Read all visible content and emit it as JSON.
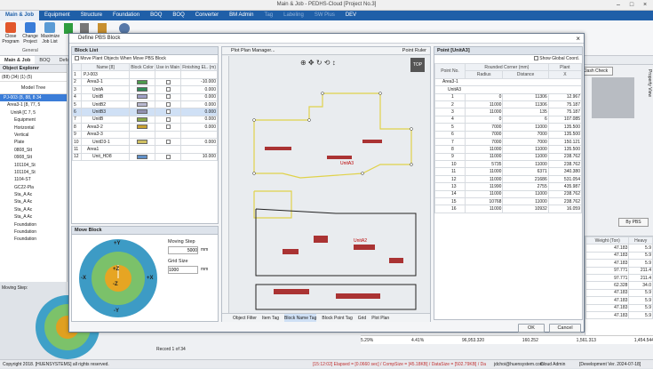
{
  "window": {
    "title": "Main & Job - PEDHS-Cloud [Project No.3]"
  },
  "menu": [
    "Main & Job",
    "Equipment",
    "Structure",
    "Foundation",
    "BOQ",
    "BOQ",
    "Converter",
    "BM Admin",
    "Tag",
    "Labeling",
    "SW Plus",
    "DEV"
  ],
  "ribbon": {
    "buttons": [
      "Close Program",
      "Change Project",
      "Maximize Job List"
    ],
    "group": "General"
  },
  "subtabs": [
    "Main & Job",
    "BOQ",
    "Defa"
  ],
  "explorer": {
    "title": "Object Explorer",
    "filters": [
      "(88)",
      "(34)",
      "(1)",
      "(5)"
    ],
    "col": "Model Tree",
    "rows": [
      "PJ-003 (8, 88, 8 34",
      "Area3-1 [8, 77, 5",
      "UnitA [C 7, 5",
      "Equipment",
      "Horizontal",
      "Vertical",
      "Plate",
      "0808_Stt",
      "0908_Stt",
      "101104_St",
      "101104_St",
      "1104-ST",
      "GC22-Pla",
      "Sta_A Ac",
      "Sta_A Ac",
      "Sta_A Ac",
      "Sta_A Ac",
      "Foundation",
      "Foundation",
      "Foundation"
    ],
    "moving_step": "Moving Step:"
  },
  "status": {
    "copyright": "Copyright 2018. [HUENSYSTEMS] all rights reserved.",
    "record": "Record 1 of 34",
    "log": "[15:12:02] Elapsed = [0.0660 sec] / CompSize = [45.18KB] / DataSize = [502.79KB] / Da",
    "user": "jdchoi@huensystem.com",
    "brand": "Cloud Admin",
    "version": "[Development Ver. 2024-07-18]"
  },
  "dialog": {
    "title": "Define PBS Block",
    "close": "×",
    "ok": "OK",
    "cancel": "Cancel"
  },
  "block_list": {
    "title": "Block List",
    "check_label": "Move Plant Objects When Move PBS Block",
    "headers": [
      "Name [8]",
      "Block Color",
      "Use in Main",
      "Finishing EL. (m)"
    ],
    "rows": [
      {
        "n": "1",
        "name": "PJ-003",
        "color": "",
        "use": false,
        "el": ""
      },
      {
        "n": "2",
        "name": "Area3-1",
        "color": "#4d9a4d",
        "use": true,
        "el": "-10.000"
      },
      {
        "n": "3",
        "name": "UnitA",
        "color": "#2e8b57",
        "use": true,
        "el": "0.000"
      },
      {
        "n": "4",
        "name": "UnitB",
        "color": "#a0a0c8",
        "use": true,
        "el": "0.000"
      },
      {
        "n": "5",
        "name": "UnitB2",
        "color": "#b8b8d0",
        "use": true,
        "el": "0.000"
      },
      {
        "n": "6",
        "name": "UnitB3",
        "color": "#9090b0",
        "use": true,
        "el": "0.000"
      },
      {
        "n": "7",
        "name": "UnitB",
        "color": "#88a848",
        "use": true,
        "el": "0.000"
      },
      {
        "n": "8",
        "name": "Area3-2",
        "color": "#c8a030",
        "use": true,
        "el": "0.000"
      },
      {
        "n": "9",
        "name": "Area3-3",
        "color": "",
        "use": false,
        "el": ""
      },
      {
        "n": "10",
        "name": "UnitD3-1",
        "color": "#d0c060",
        "use": true,
        "el": "0.000"
      },
      {
        "n": "11",
        "name": "Area1",
        "color": "",
        "use": false,
        "el": ""
      },
      {
        "n": "12",
        "name": "Unit_HD8",
        "color": "#6090c8",
        "use": true,
        "el": "10.000"
      }
    ]
  },
  "move_block": {
    "title": "Move Block",
    "moving_step_label": "Moving Step",
    "moving_step": "5000",
    "grid_size_label": "Grid Size",
    "grid_size": "1000",
    "unit": "mm",
    "controls": {
      "up": "+Y",
      "down": "-Y",
      "left": "-X",
      "right": "+X",
      "zup": "+Z",
      "zdown": "-Z"
    }
  },
  "plot": {
    "title": "Plot Plan Manager...",
    "point_ruler": "Point Ruler",
    "top": "TOP",
    "labels": [
      "UnitA3",
      "UnitA2"
    ],
    "tabs": [
      "Object Filter",
      "Item Tag",
      "Block Name Tag",
      "Block Point Tag",
      "Grid",
      "Plot Plan"
    ]
  },
  "point_grid": {
    "title": "Point [UnitA3]",
    "global": "Show Global Coord.",
    "headers": [
      "Point No.",
      "Rounded Corner (mm)",
      "Plant"
    ],
    "sub": [
      "Radius",
      "Distance",
      "X"
    ],
    "groups": [
      "Area3-1",
      "UnitA3"
    ],
    "rows": [
      [
        "1",
        "0",
        "11306",
        "12.967"
      ],
      [
        "2",
        "11000",
        "11306",
        "75.187"
      ],
      [
        "3",
        "11000",
        "135",
        "75.187"
      ],
      [
        "4",
        "0",
        "6",
        "107.085"
      ],
      [
        "5",
        "7000",
        "11000",
        "135.500"
      ],
      [
        "6",
        "7000",
        "7000",
        "135.500"
      ],
      [
        "7",
        "7000",
        "7000",
        "150.121"
      ],
      [
        "8",
        "11000",
        "11000",
        "135.500"
      ],
      [
        "9",
        "11000",
        "11000",
        "238.762"
      ],
      [
        "10",
        "5735",
        "11000",
        "238.762"
      ],
      [
        "11",
        "11000",
        "6371",
        "340.380"
      ],
      [
        "12",
        "11000",
        "21686",
        "531.054"
      ],
      [
        "13",
        "11990",
        "2755",
        "435.987"
      ],
      [
        "14",
        "11000",
        "11000",
        "238.762"
      ],
      [
        "15",
        "10768",
        "11000",
        "238.762"
      ],
      [
        "16",
        "11000",
        "10932",
        "16.059"
      ]
    ]
  },
  "right_panel": {
    "clash": "Clash Check",
    "by_pbs": "By PBS",
    "property": "Property View",
    "headers": [
      "Weight (Ton)",
      "Heavy"
    ],
    "rows": [
      [
        "47.183",
        "5.9"
      ],
      [
        "47.183",
        "5.9"
      ],
      [
        "47.183",
        "5.9"
      ],
      [
        "97.771",
        "211.4"
      ],
      [
        "97.771",
        "211.4"
      ],
      [
        "62.328",
        "34.0"
      ],
      [
        "47.183",
        "5.9"
      ],
      [
        "47.183",
        "5.9"
      ],
      [
        "47.183",
        "5.9"
      ],
      [
        "47.183",
        "5.9"
      ]
    ],
    "totals": [
      "5.29%",
      "4.41%",
      "96,953.320",
      "160.252",
      "1,561.313",
      "1,454.544"
    ]
  }
}
